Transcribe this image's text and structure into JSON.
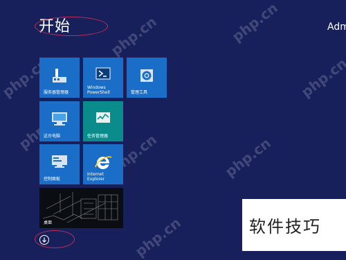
{
  "start": {
    "title": "开始",
    "user_name": "Admi"
  },
  "tiles": {
    "server_manager": {
      "label": "服务器管理器",
      "color": "#1a6ec7",
      "icon": "server-manager-icon"
    },
    "powershell": {
      "label": "Windows\nPowerShell",
      "color": "#1a6ec7",
      "icon": "powershell-icon"
    },
    "admin_tools": {
      "label": "管理工具",
      "color": "#1a6ec7",
      "icon": "admin-tools-icon"
    },
    "computer": {
      "label": "这台电脑",
      "color": "#1a6ec7",
      "icon": "computer-icon"
    },
    "task_manager": {
      "label": "任务管理器",
      "color": "#0a8c8c",
      "icon": "task-manager-icon"
    },
    "control_panel": {
      "label": "控制面板",
      "color": "#1a6ec7",
      "icon": "control-panel-icon"
    },
    "internet_explorer": {
      "label": "Internet\nExplorer",
      "color": "#1a6ec7",
      "icon": "internet-explorer-icon"
    },
    "desktop": {
      "label": "桌面",
      "color": "#0a0e12"
    }
  },
  "watermark": {
    "text": "php.cn"
  },
  "corner_badge": {
    "text": "软件技巧"
  },
  "colors": {
    "background": "#18205c",
    "tile_blue": "#1a6ec7",
    "tile_teal": "#0a8c8c",
    "highlight_ellipse": "#c22c55"
  }
}
